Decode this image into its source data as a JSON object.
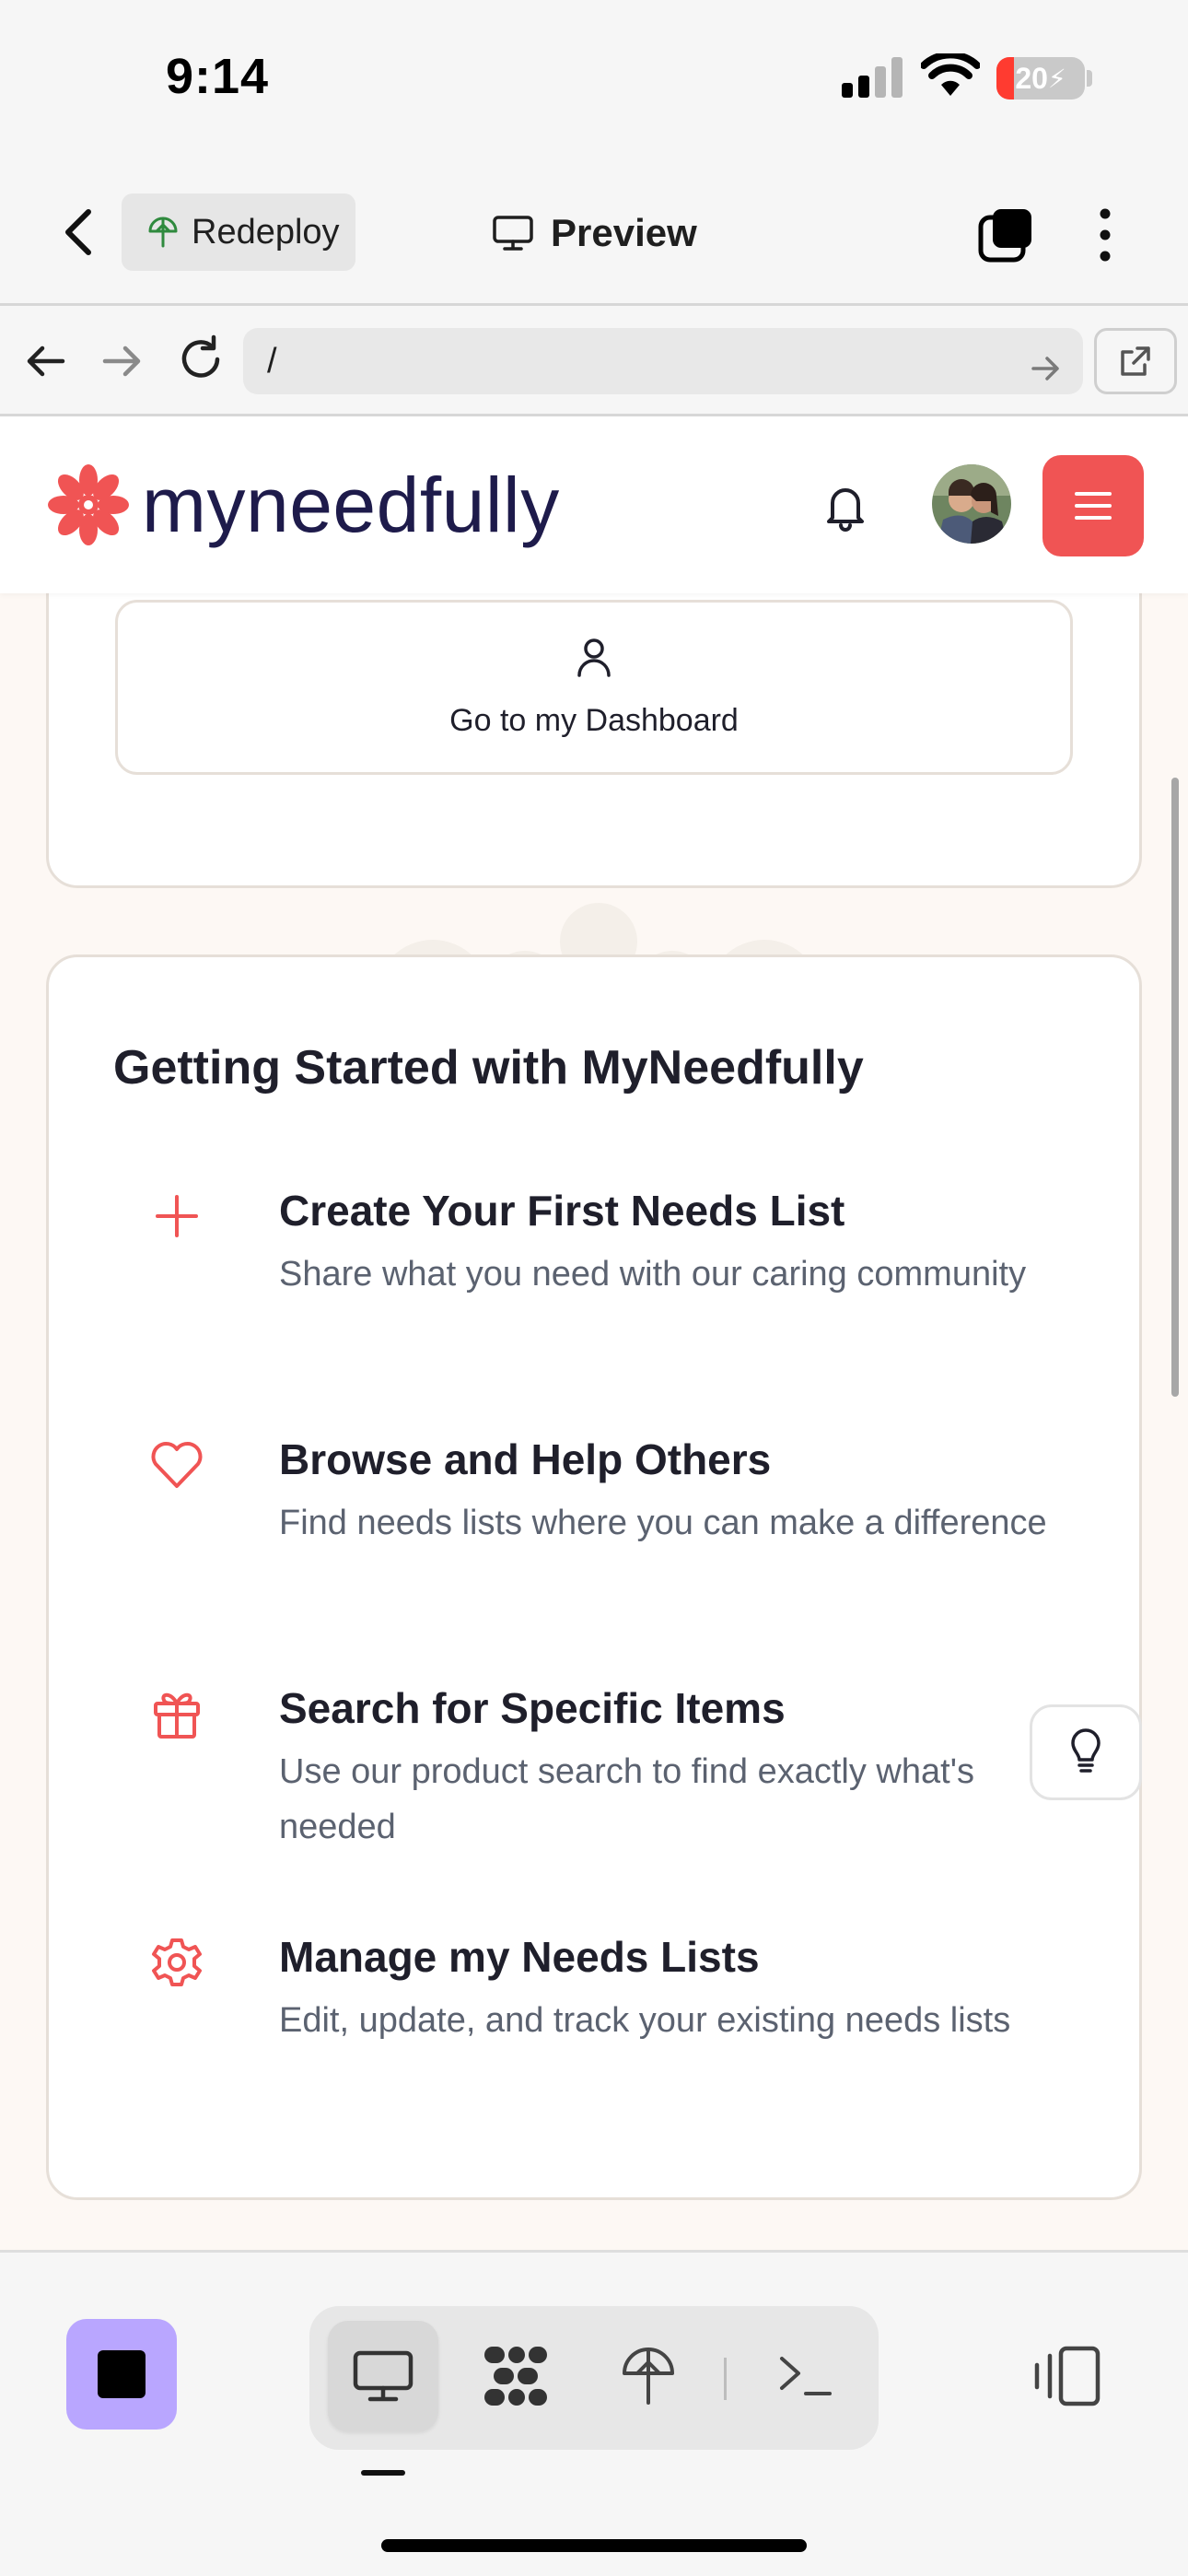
{
  "status_bar": {
    "time": "9:14",
    "battery_text": "20",
    "battery_level": 0.2,
    "icons": [
      "cellular-signal-icon",
      "wifi-icon",
      "battery-charging-icon"
    ]
  },
  "app_header": {
    "back_icon": "chevron-left-icon",
    "redeploy_label": "Redeploy",
    "preview_label": "Preview",
    "tabs_icon": "tabs-icon",
    "more_icon": "more-vertical-icon"
  },
  "url_bar": {
    "url": "/",
    "icons": [
      "arrow-left-icon",
      "arrow-right-icon",
      "reload-icon",
      "arrow-right-icon",
      "external-link-icon"
    ]
  },
  "site": {
    "brand_name": "myneedfully",
    "brand_color": "#f05454",
    "brand_text_color": "#1e1b4b",
    "dashboard_button_label": "Go to my Dashboard",
    "getting_started": {
      "title": "Getting Started with MyNeedfully",
      "items": [
        {
          "icon": "plus-icon",
          "title": "Create Your First Needs List",
          "description": "Share what you need with our caring community"
        },
        {
          "icon": "heart-icon",
          "title": "Browse and Help Others",
          "description": "Find needs lists where you can make a difference"
        },
        {
          "icon": "gift-icon",
          "title": "Search for Specific Items",
          "description": "Use our product search to find exactly what's needed"
        },
        {
          "icon": "gear-icon",
          "title": "Manage my Needs Lists",
          "description": "Edit, update, and track your existing needs lists"
        }
      ]
    }
  },
  "bottom_toolbar": {
    "accent": "#b9a6ff",
    "icons": [
      "stop-icon",
      "desktop-icon",
      "workspace-icon",
      "deploy-icon",
      "terminal-icon",
      "split-view-icon"
    ]
  }
}
